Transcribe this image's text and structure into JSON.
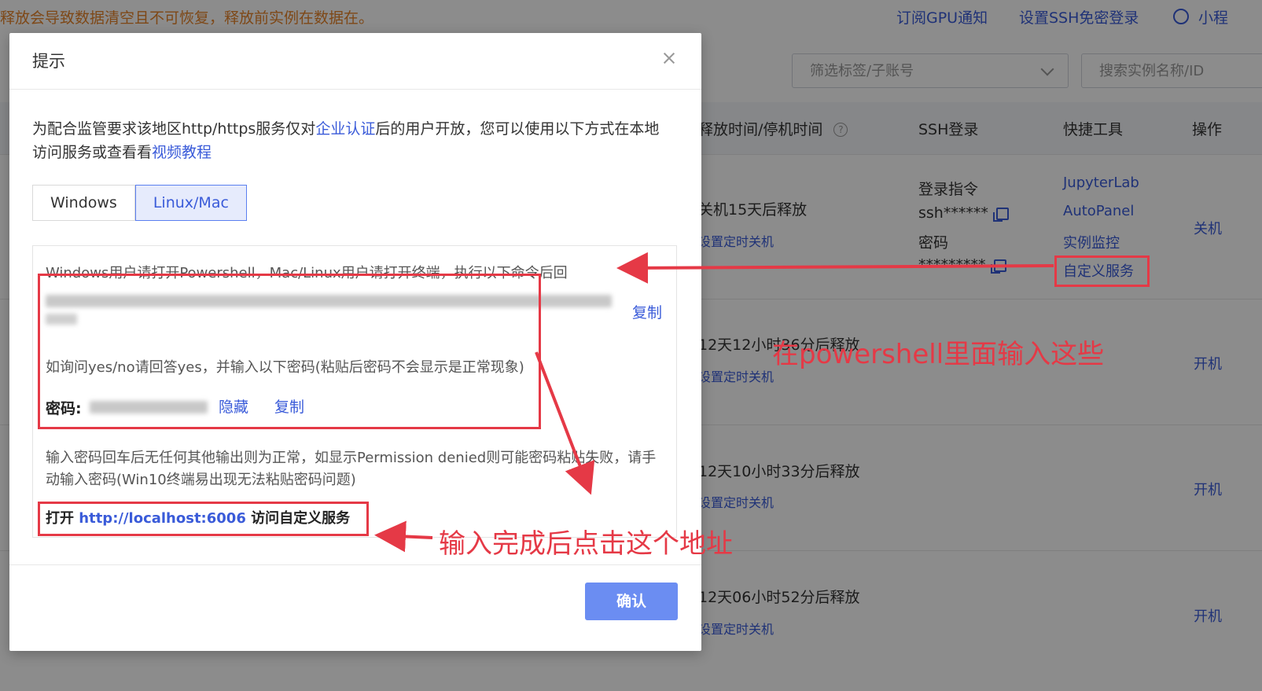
{
  "background": {
    "warning": "释放会导致数据清空且不可恢复，释放前实例在数据在。",
    "top_links": [
      "订阅GPU通知",
      "设置SSH免密登录",
      "小程"
    ],
    "filter_placeholder": "筛选标签/子账号",
    "search_placeholder": "搜索实例名称/ID",
    "columns": [
      "释放时间/停机时间",
      "SSH登录",
      "快捷工具",
      "操作"
    ],
    "ssh": {
      "login_cmd_label": "登录指令",
      "login_cmd_value": "ssh******",
      "password_label": "密码",
      "password_value": "*********"
    },
    "tools": [
      "JupyterLab",
      "AutoPanel",
      "实例监控",
      "自定义服务"
    ],
    "rows": [
      {
        "release": "关机15天后释放",
        "schedule": "设置定时关机",
        "action": "关机"
      },
      {
        "release": "12天12小时36分后释放",
        "schedule": "设置定时关机",
        "action": "开机"
      },
      {
        "release": "12天10小时33分后释放",
        "schedule": "设置定时关机",
        "action": "开机"
      },
      {
        "release": "12天06小时52分后释放",
        "schedule": "设置定时关机",
        "action": "开机"
      }
    ]
  },
  "dialog": {
    "title": "提示",
    "intro_prefix": "为配合监管要求该地区http/https服务仅对",
    "intro_link1": "企业认证",
    "intro_middle": "后的用户开放，您可以使用以下方式在本地访问服务或查看看",
    "intro_link2": "视频教程",
    "tabs": [
      "Windows",
      "Linux/Mac"
    ],
    "active_tab": "Linux/Mac",
    "panel": {
      "instruction": "Windows用户请打开Powershell，Mac/Linux用户请打开终端，执行以下命令后回",
      "copy_label": "复制",
      "yes_no_hint": "如询问yes/no请回答yes，并输入以下密码(粘贴后密码不会显示是正常现象)",
      "password_label": "密码:",
      "hide_label": "隐藏",
      "password_copy_label": "复制",
      "after_password_hint": "输入密码回车后无任何其他输出则为正常，如显示Permission denied则可能密码粘贴失败，请手动输入密码(Win10终端易出现无法粘贴密码问题)",
      "open_prefix": "打开",
      "open_url": "http://localhost:6006",
      "open_suffix": "访问自定义服务"
    },
    "confirm_label": "确认"
  },
  "annotations": {
    "text1": "在powershell里面输入这些",
    "text2": "输入完成后点击这个地址",
    "color": "#e53946"
  }
}
